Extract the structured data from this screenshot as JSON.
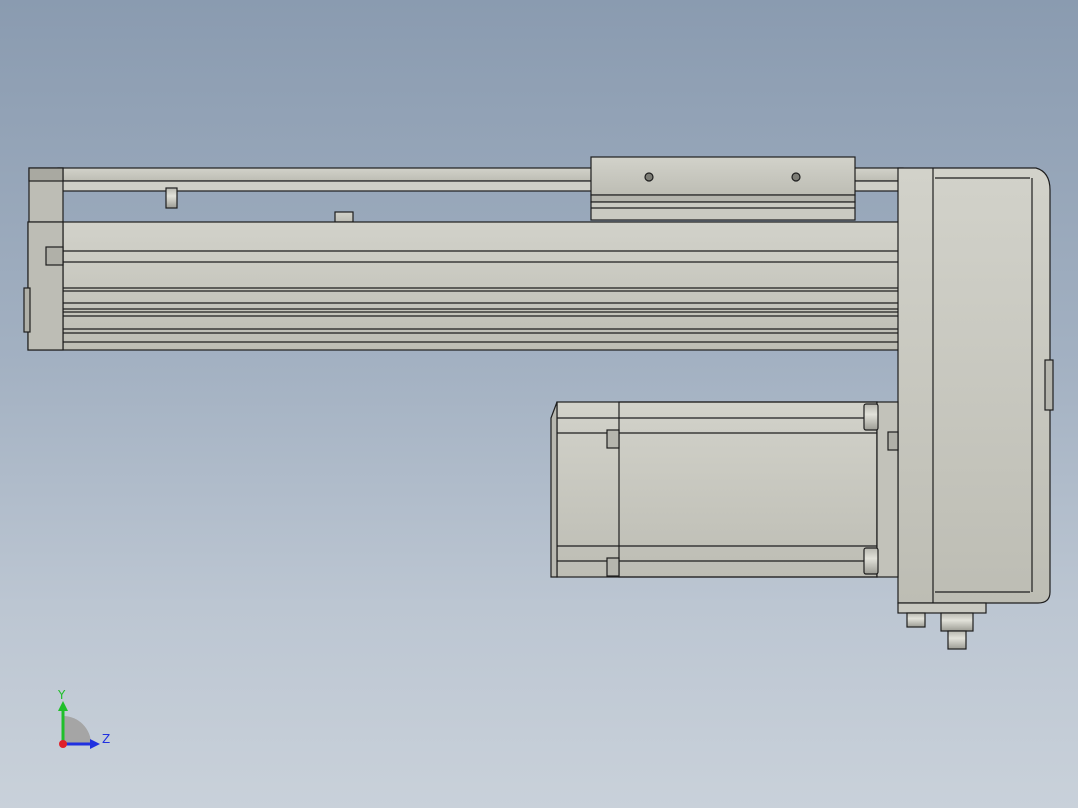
{
  "viewport": {
    "background_top": "#8a9bb0",
    "background_bottom": "#c9d1da"
  },
  "model": {
    "description_icon": "linear-actuator-with-side-motor",
    "body_color": "#c6c6bd",
    "edge_color": "#1e1e1e"
  },
  "triad": {
    "y_label": "Y",
    "z_label": "Z",
    "colors": {
      "x": "#e0202a",
      "y": "#1fbf2a",
      "z": "#2030e0"
    }
  }
}
